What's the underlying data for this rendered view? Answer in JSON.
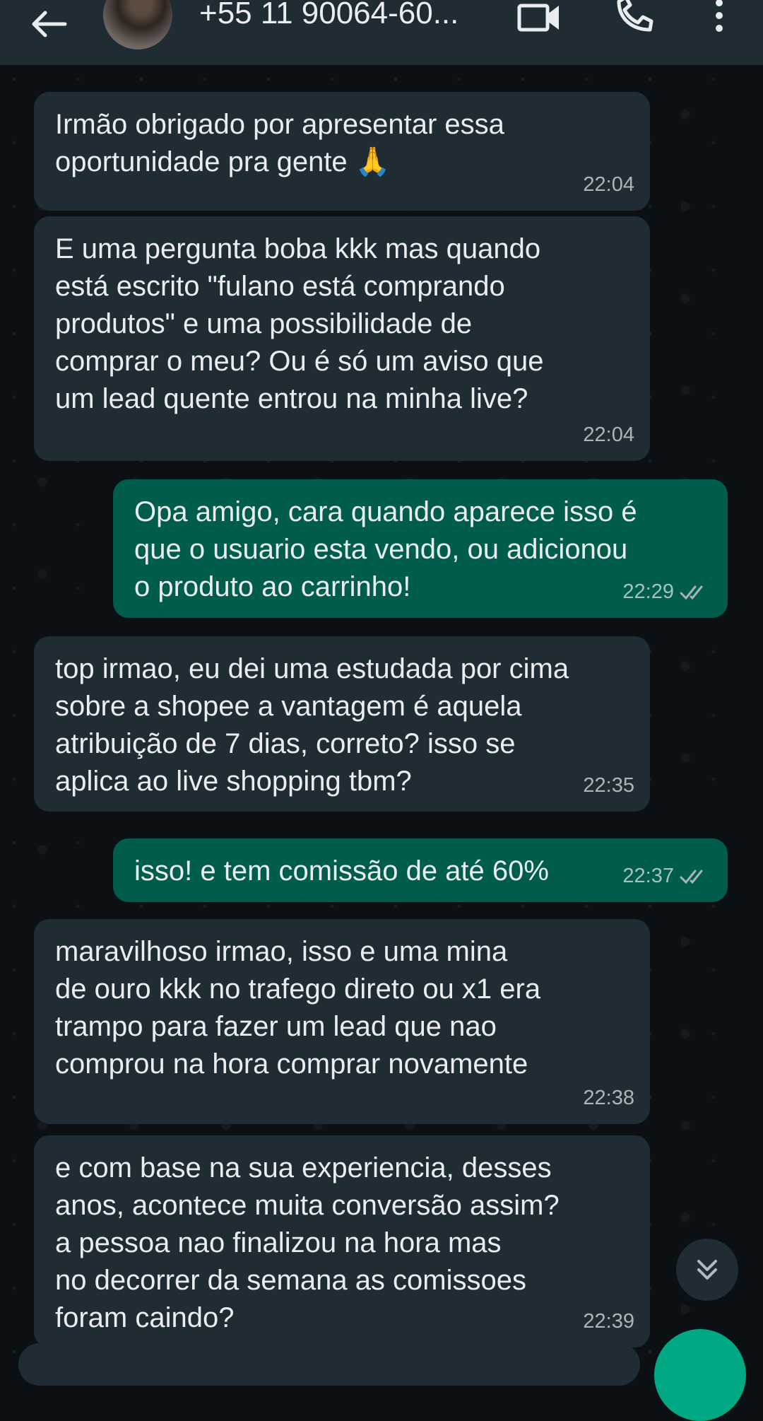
{
  "header": {
    "contact_name": "+55 11 90064-60..."
  },
  "messages": [
    {
      "direction": "in",
      "text": "Irmão obrigado por apresentar essa\noportunidade pra gente 🙏",
      "time": "22:04"
    },
    {
      "direction": "in",
      "text": "E uma pergunta boba kkk mas quando\nestá escrito \"fulano está comprando\nprodutos\" e uma possibilidade de\ncomprar o meu? Ou é só um aviso que\num lead quente entrou na minha live?",
      "time": "22:04"
    },
    {
      "direction": "out",
      "text": "Opa amigo, cara quando aparece isso é\nque o usuario esta vendo, ou adicionou\no produto ao carrinho!",
      "time": "22:29",
      "status": "read"
    },
    {
      "direction": "in",
      "text": "top irmao, eu dei uma estudada por cima\nsobre a shopee a vantagem é aquela\natribuição de 7 dias, correto? isso se\naplica ao live shopping tbm?",
      "time": "22:35"
    },
    {
      "direction": "out",
      "text": "isso! e tem comissão de até 60%",
      "time": "22:37",
      "status": "read"
    },
    {
      "direction": "in",
      "text": "maravilhoso irmao, isso e uma mina\nde ouro kkk no trafego direto ou x1 era\ntrampo para fazer um lead que nao\ncomprou na hora comprar novamente",
      "time": "22:38"
    },
    {
      "direction": "in",
      "text": "e com base na sua experiencia, desses\nanos, acontece muita conversão assim?\na pessoa nao finalizou na hora mas\nno decorrer da semana as comissoes\nforam caindo?",
      "time": "22:39"
    }
  ],
  "colors": {
    "background": "#0b1014",
    "incoming_bubble": "#1f2c33",
    "outgoing_bubble": "#005c4b",
    "read_ticks": "#a6b3ba"
  },
  "icons": [
    "back-arrow-icon",
    "video-call-icon",
    "phone-icon",
    "more-vert-icon",
    "double-check-icon",
    "chevron-double-down-icon"
  ]
}
